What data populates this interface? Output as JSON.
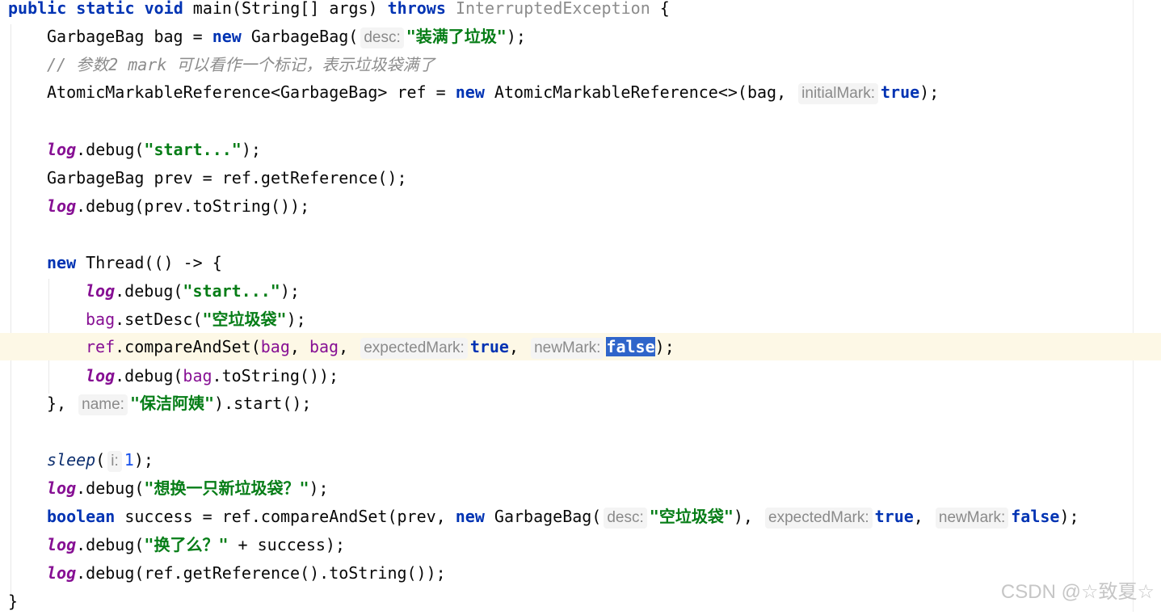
{
  "code": {
    "l1_kw1": "public",
    "l1_kw2": "static",
    "l1_kw3": "void",
    "l1_sig": " main(String[] args) ",
    "l1_throws": "throws",
    "l1_exc": "InterruptedException",
    "l1_end": " {",
    "l2_a": "GarbageBag bag = ",
    "l2_new": "new",
    "l2_b": " GarbageBag(",
    "l2_hint": "desc:",
    "l2_str": "\"装满了垃圾\"",
    "l2_end": ");",
    "l3_comment": "// 参数2 mark 可以看作一个标记，表示垃圾袋满了",
    "l4_a": "AtomicMarkableReference<GarbageBag> ref = ",
    "l4_new": "new",
    "l4_b": " AtomicMarkableReference<>(bag, ",
    "l4_hint": "initialMark:",
    "l4_true": "true",
    "l4_end": ");",
    "l6_log": "log",
    "l6_a": ".debug(",
    "l6_str": "\"start...\"",
    "l6_end": ");",
    "l7": "GarbageBag prev = ref.getReference();",
    "l8_log": "log",
    "l8_a": ".debug(prev.toString());",
    "l10_new": "new",
    "l10_a": " Thread(() -> {",
    "l11_log": "log",
    "l11_a": ".debug(",
    "l11_str": "\"start...\"",
    "l11_end": ");",
    "l12_bag": "bag",
    "l12_a": ".setDesc(",
    "l12_str": "\"空垃圾袋\"",
    "l12_end": ");",
    "l13_ref": "ref",
    "l13_a": ".compareAndSet(",
    "l13_bag1": "bag",
    "l13_c1": ", ",
    "l13_bag2": "bag",
    "l13_c2": ", ",
    "l13_hint1": "expectedMark:",
    "l13_true": "true",
    "l13_c3": ", ",
    "l13_hint2": "newMark:",
    "l13_false": "false",
    "l13_end": ");",
    "l14_log": "log",
    "l14_a": ".debug(",
    "l14_bag": "bag",
    "l14_b": ".toString());",
    "l15_a": "}, ",
    "l15_hint": "name:",
    "l15_str": "\"保洁阿姨\"",
    "l15_end": ").start();",
    "l17_sleep": "sleep",
    "l17_a": "(",
    "l17_hint": "i:",
    "l17_num": "1",
    "l17_end": ");",
    "l18_log": "log",
    "l18_a": ".debug(",
    "l18_str": "\"想换一只新垃圾袋？\"",
    "l18_end": ");",
    "l19_bool": "boolean",
    "l19_a": " success = ref.compareAndSet(prev, ",
    "l19_new": "new",
    "l19_b": " GarbageBag(",
    "l19_hint1": "desc:",
    "l19_str": "\"空垃圾袋\"",
    "l19_c1": "), ",
    "l19_hint2": "expectedMark:",
    "l19_true": "true",
    "l19_c2": ", ",
    "l19_hint3": "newMark:",
    "l19_false": "false",
    "l19_end": ");",
    "l20_log": "log",
    "l20_a": ".debug(",
    "l20_str": "\"换了么？\"",
    "l20_b": " + success);",
    "l21_log": "log",
    "l21_a": ".debug(ref.getReference().toString());",
    "l22": "}"
  },
  "watermark": "CSDN @☆致夏☆",
  "colors": {
    "keyword": "#0033b3",
    "string": "#067d17",
    "comment": "#8c8c8c",
    "log_field": "#871094",
    "number": "#1750eb",
    "selection": "#2f65ca",
    "current_line": "#fdf8e6"
  }
}
